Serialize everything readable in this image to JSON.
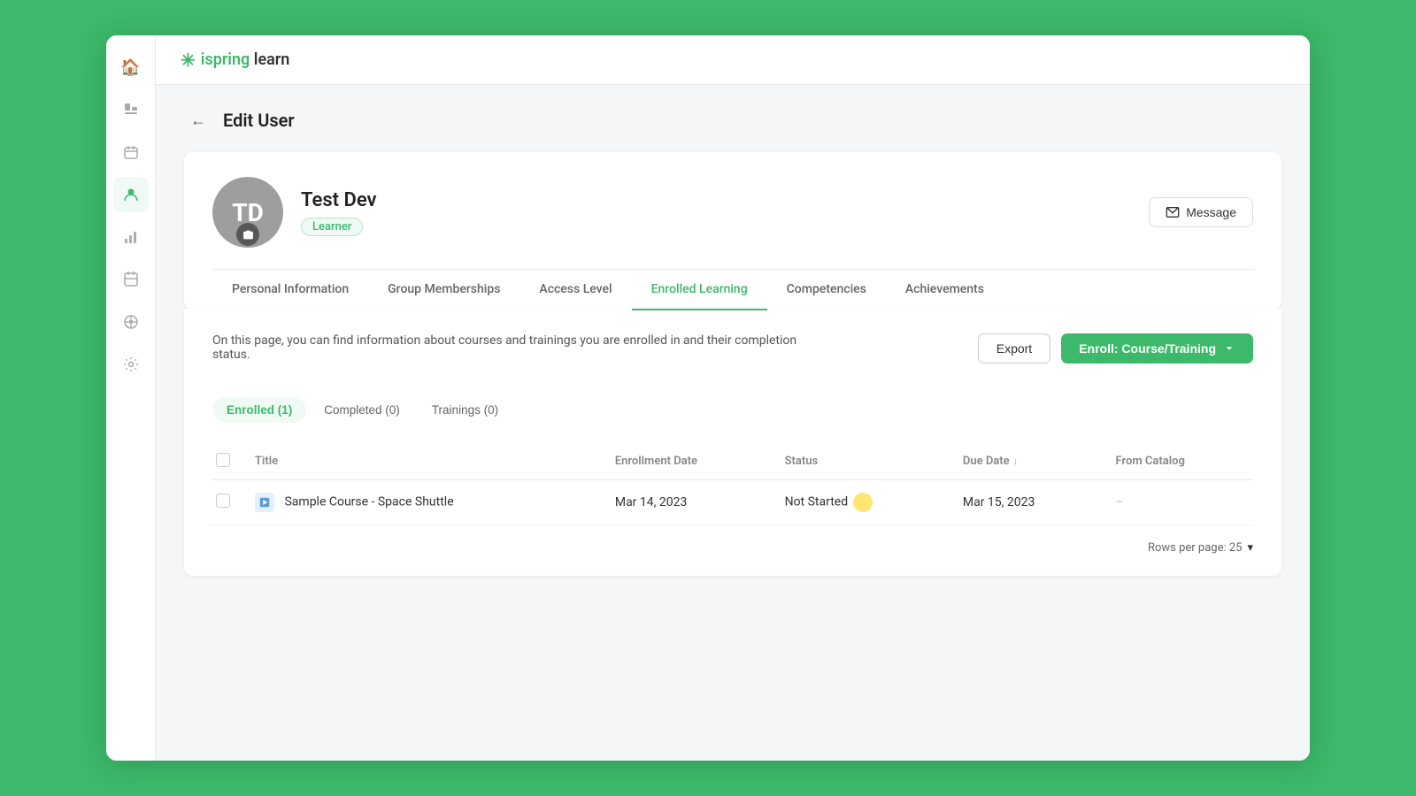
{
  "app": {
    "logo": "ispring learn",
    "logo_icon": "✳"
  },
  "sidebar": {
    "items": [
      {
        "icon": "🏠",
        "name": "home",
        "active": false
      },
      {
        "icon": "📋",
        "name": "reports",
        "active": false
      },
      {
        "icon": "📅",
        "name": "calendar",
        "active": false
      },
      {
        "icon": "👥",
        "name": "users",
        "active": true
      },
      {
        "icon": "📊",
        "name": "analytics",
        "active": false
      },
      {
        "icon": "📆",
        "name": "schedule",
        "active": false
      },
      {
        "icon": "🤖",
        "name": "automation",
        "active": false
      },
      {
        "icon": "⚙",
        "name": "settings",
        "active": false
      }
    ]
  },
  "page": {
    "title": "Edit User",
    "back_label": "←"
  },
  "user": {
    "initials": "TD",
    "name": "Test Dev",
    "role": "Learner",
    "message_btn": "Message"
  },
  "tabs": [
    {
      "label": "Personal Information",
      "active": false
    },
    {
      "label": "Group Memberships",
      "active": false
    },
    {
      "label": "Access Level",
      "active": false
    },
    {
      "label": "Enrolled Learning",
      "active": true
    },
    {
      "label": "Competencies",
      "active": false
    },
    {
      "label": "Achievements",
      "active": false
    }
  ],
  "enrolled_panel": {
    "description": "On this page, you can find information about courses and trainings you are enrolled in and their completion status.",
    "export_btn": "Export",
    "enroll_btn": "Enroll: Course/Training",
    "sub_tabs": [
      {
        "label": "Enrolled (1)",
        "active": true
      },
      {
        "label": "Completed (0)",
        "active": false
      },
      {
        "label": "Trainings (0)",
        "active": false
      }
    ],
    "table": {
      "columns": [
        {
          "label": "",
          "key": "checkbox"
        },
        {
          "label": "Title",
          "key": "title"
        },
        {
          "label": "Enrollment Date",
          "key": "enrollment_date"
        },
        {
          "label": "Status",
          "key": "status"
        },
        {
          "label": "Due Date",
          "key": "due_date",
          "sortable": true
        },
        {
          "label": "From Catalog",
          "key": "from_catalog"
        }
      ],
      "rows": [
        {
          "title": "Sample Course - Space Shuttle",
          "enrollment_date": "Mar 14, 2023",
          "status": "Not Started",
          "due_date": "Mar 15, 2023",
          "from_catalog": "–"
        }
      ]
    },
    "rows_per_page_label": "Rows per page: 25"
  }
}
